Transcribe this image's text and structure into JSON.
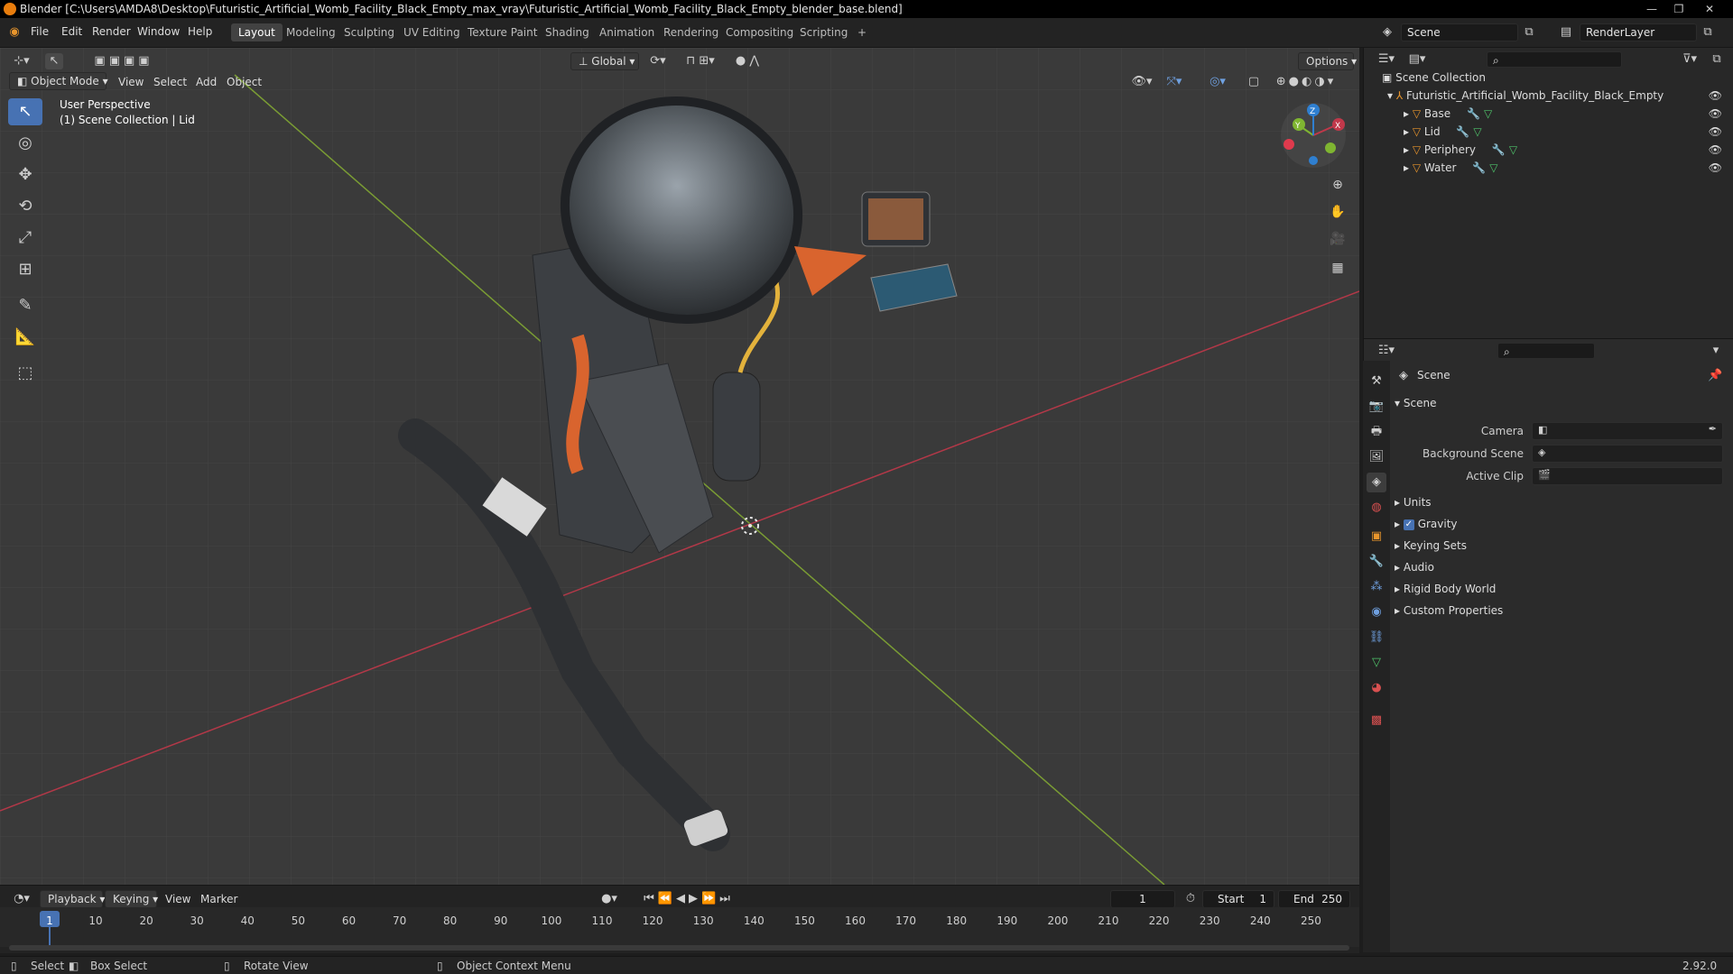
{
  "window": {
    "title": "Blender [C:\\Users\\AMDA8\\Desktop\\Futuristic_Artificial_Womb_Facility_Black_Empty_max_vray\\Futuristic_Artificial_Womb_Facility_Black_Empty_blender_base.blend]",
    "min": "—",
    "max": "❐",
    "close": "✕"
  },
  "menu": [
    "File",
    "Edit",
    "Render",
    "Window",
    "Help"
  ],
  "workspaces": [
    "Layout",
    "Modeling",
    "Sculpting",
    "UV Editing",
    "Texture Paint",
    "Shading",
    "Animation",
    "Rendering",
    "Compositing",
    "Scripting"
  ],
  "add_tab": "+",
  "scene_field": "Scene",
  "renderlayer_field": "RenderLayer",
  "viewport": {
    "mode": "Object Mode",
    "menus": [
      "View",
      "Select",
      "Add",
      "Object"
    ],
    "orientation": "Global",
    "options": "Options",
    "overlay_line1": "User Perspective",
    "overlay_line2": "(1) Scene Collection | Lid",
    "gizmo": {
      "x": "X",
      "y": "Y",
      "z": "Z"
    }
  },
  "outliner": {
    "root": "Scene Collection",
    "collection": "Futuristic_Artificial_Womb_Facility_Black_Empty",
    "objects": [
      "Base",
      "Lid",
      "Periphery",
      "Water"
    ]
  },
  "properties": {
    "header": "Scene",
    "panel": "Scene",
    "fields": [
      {
        "label": "Camera"
      },
      {
        "label": "Background Scene"
      },
      {
        "label": "Active Clip"
      }
    ],
    "subpanels": [
      "Units",
      "Gravity",
      "Keying Sets",
      "Audio",
      "Rigid Body World",
      "Custom Properties"
    ],
    "gravity_checked": true
  },
  "timeline": {
    "menus": [
      "Playback",
      "Keying",
      "View",
      "Marker"
    ],
    "current_frame": "1",
    "start_label": "Start",
    "start": "1",
    "end_label": "End",
    "end": "250",
    "ticks": [
      "1",
      "10",
      "20",
      "30",
      "40",
      "50",
      "60",
      "70",
      "80",
      "90",
      "100",
      "110",
      "120",
      "130",
      "140",
      "150",
      "160",
      "170",
      "180",
      "190",
      "200",
      "210",
      "220",
      "230",
      "240",
      "250"
    ]
  },
  "status": {
    "select": "Select",
    "box_select": "Box Select",
    "rotate_view": "Rotate View",
    "context_menu": "Object Context Menu",
    "version": "2.92.0"
  },
  "colors": {
    "accent": "#4772b3",
    "x_axis": "#c0384a",
    "y_axis": "#7fb531",
    "z_axis": "#2f7fd0",
    "object_icon": "#e8952c"
  }
}
